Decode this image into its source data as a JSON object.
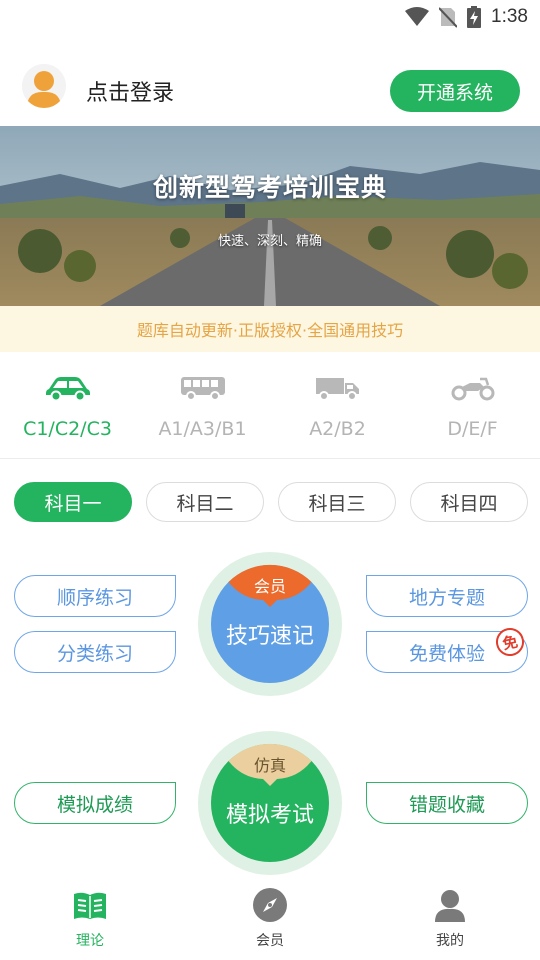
{
  "status_bar": {
    "time": "1:38"
  },
  "header": {
    "login_text": "点击登录",
    "open_button": "开通系统"
  },
  "banner": {
    "title": "创新型驾考培训宝典",
    "subtitle": "快速、深刻、精确",
    "notice": "题库自动更新·正版授权·全国通用技巧"
  },
  "vehicles": [
    {
      "label": "C1/C2/C3",
      "icon": "car-icon",
      "active": true
    },
    {
      "label": "A1/A3/B1",
      "icon": "bus-icon",
      "active": false
    },
    {
      "label": "A2/B2",
      "icon": "truck-icon",
      "active": false
    },
    {
      "label": "D/E/F",
      "icon": "motorcycle-icon",
      "active": false
    }
  ],
  "subjects": [
    {
      "label": "科目一",
      "active": true
    },
    {
      "label": "科目二",
      "active": false
    },
    {
      "label": "科目三",
      "active": false
    },
    {
      "label": "科目四",
      "active": false
    }
  ],
  "features": {
    "sequential": "顺序练习",
    "category": "分类练习",
    "local_topics": "地方专题",
    "free_trial": "免费体验",
    "free_badge": "免",
    "skills": {
      "tag": "会员",
      "label": "技巧速记"
    },
    "mock_score": "模拟成绩",
    "wrong_collection": "错题收藏",
    "mock_exam": {
      "tag": "仿真",
      "label": "模拟考试"
    }
  },
  "bottom_nav": [
    {
      "label": "理论",
      "icon": "book-icon",
      "active": true
    },
    {
      "label": "会员",
      "icon": "compass-icon",
      "active": false
    },
    {
      "label": "我的",
      "icon": "user-icon",
      "active": false
    }
  ],
  "colors": {
    "primary_green": "#24b35f",
    "accent_blue": "#5b97e0",
    "member_orange": "#ec6a2b",
    "notice_text": "#e5a445",
    "notice_bg": "#fdf7e1",
    "simulation_tan": "#ebcf9e"
  }
}
